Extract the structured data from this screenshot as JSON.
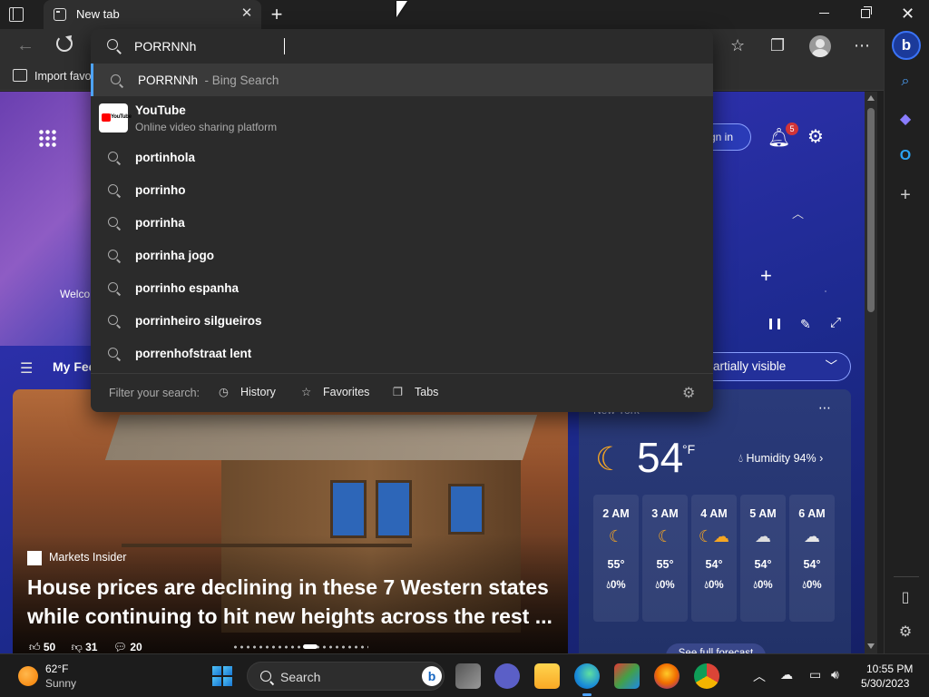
{
  "browser": {
    "tab_title": "New tab",
    "favorites_bar": {
      "import_label": "Import favo"
    }
  },
  "omnibox": {
    "query": "PORRNNh",
    "bing_suggestion": {
      "text": "PORRNNh",
      "suffix": "- Bing Search"
    },
    "site_suggestion": {
      "title": "YouTube",
      "subtitle": "Online video sharing platform"
    },
    "suggestions": [
      "portinhola",
      "porrinho",
      "porrinha",
      "porrinha jogo",
      "porrinho espanha",
      "porrinheiro silgueiros",
      "porrenhofstraat lent"
    ],
    "footer": {
      "filter_label": "Filter your search:",
      "history": "History",
      "favorites": "Favorites",
      "tabs": "Tabs"
    }
  },
  "newtab": {
    "welcome_label": "Welco",
    "sign_in": "gn in",
    "notifications_count": "5",
    "feed_label": "My Fee",
    "visibility_label": "artially visible",
    "news": {
      "source": "Markets Insider",
      "headline": "House prices are declining in these 7 Western states while continuing to hit new heights across the rest ...",
      "likes": "50",
      "dislikes": "31",
      "comments": "20"
    },
    "weather": {
      "location": "New York",
      "temperature": "54",
      "unit": "°F",
      "humidity": "Humidity 94%",
      "hourly": [
        {
          "time": "2 AM",
          "temp": "55°",
          "precip": "0%",
          "icon": "moon-icon"
        },
        {
          "time": "3 AM",
          "temp": "55°",
          "precip": "0%",
          "icon": "moon-icon"
        },
        {
          "time": "4 AM",
          "temp": "54°",
          "precip": "0%",
          "icon": "moon-cloud-icon"
        },
        {
          "time": "5 AM",
          "temp": "54°",
          "precip": "0%",
          "icon": "moon-cloud-icon"
        },
        {
          "time": "6 AM",
          "temp": "54°",
          "precip": "0%",
          "icon": "cloud-icon"
        }
      ],
      "full_forecast": "See full forecast"
    }
  },
  "taskbar": {
    "weather_temp": "62°F",
    "weather_cond": "Sunny",
    "search_label": "Search",
    "time": "10:55 PM",
    "date": "5/30/2023"
  },
  "colors": {
    "accent": "#4da3ff",
    "badge": "#d13438",
    "moon": "#f5a623"
  }
}
